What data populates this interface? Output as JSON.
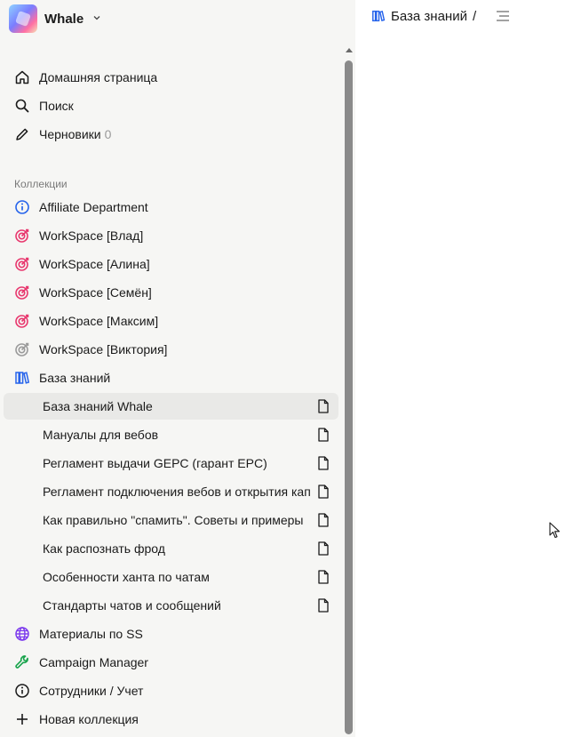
{
  "workspace": {
    "name": "Whale",
    "logo_icon": "workspace-logo-icon"
  },
  "nav": {
    "home": "Домашняя страница",
    "search": "Поиск",
    "drafts": "Черновики",
    "drafts_count": "0"
  },
  "collections_label": "Коллекции",
  "collections": [
    {
      "label": "Affiliate Department",
      "icon": "info-icon",
      "color": "#2563eb"
    },
    {
      "label": "WorkSpace [Влад]",
      "icon": "target-icon",
      "color": "#e8366d"
    },
    {
      "label": "WorkSpace [Алина]",
      "icon": "target-icon",
      "color": "#e8366d"
    },
    {
      "label": "WorkSpace [Семён]",
      "icon": "target-icon",
      "color": "#e8366d"
    },
    {
      "label": "WorkSpace [Максим]",
      "icon": "target-icon",
      "color": "#e8366d"
    },
    {
      "label": "WorkSpace [Виктория]",
      "icon": "target-icon",
      "color": "#9a9a9a"
    },
    {
      "label": "База знаний",
      "icon": "books-icon",
      "color": "#2563eb"
    }
  ],
  "documents": [
    {
      "label": "База знаний Whale",
      "active": true
    },
    {
      "label": "Мануалы для вебов"
    },
    {
      "label": "Регламент выдачи GEPC (гарант EPC)"
    },
    {
      "label": "Регламент подключения вебов и открытия кап"
    },
    {
      "label": "Как правильно \"спамить\". Советы и примеры"
    },
    {
      "label": "Как распознать фрод"
    },
    {
      "label": "Особенности ханта по чатам"
    },
    {
      "label": "Стандарты чатов и сообщений"
    }
  ],
  "more_collections": [
    {
      "label": "Материалы по SS",
      "icon": "globe-icon",
      "color": "#7c3aed"
    },
    {
      "label": "Campaign Manager",
      "icon": "wrench-icon",
      "color": "#16a34a"
    },
    {
      "label": "Сотрудники / Учет",
      "icon": "info-icon",
      "color": "#1a1a1a"
    }
  ],
  "new_collection": "Новая коллекция",
  "breadcrumb": {
    "title": "База знаний",
    "separator": "/"
  }
}
